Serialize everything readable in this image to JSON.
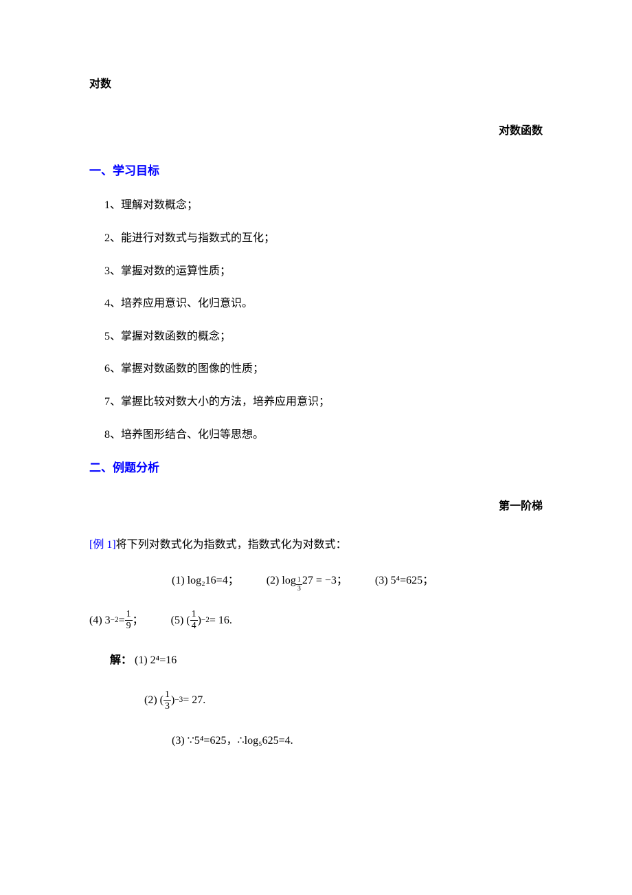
{
  "title_main": "对数",
  "title_right": "对数函数",
  "section1": {
    "heading": "一、学习目标",
    "goals": [
      "1、理解对数概念；",
      "2、能进行对数式与指数式的互化；",
      "3、掌握对数的运算性质；",
      "4、培养应用意识、化归意识。",
      "5、掌握对数函数的概念；",
      "6、掌握对数函数的图像的性质；",
      "7、掌握比较对数大小的方法，培养应用意识；",
      "8、培养图形结合、化归等思想。"
    ]
  },
  "section2": {
    "heading": "二、例题分析",
    "stage": "第一阶梯",
    "example": {
      "label": "[例 1]",
      "text": "将下列对数式化为指数式，指数式化为对数式：",
      "eq1": "(1) log₂16=4；",
      "eq2_pre": "(2) log",
      "eq2_sub_num": "1",
      "eq2_sub_den": "3",
      "eq2_post": " 27 = −3；",
      "eq3": "(3) 5⁴=625；",
      "eq4_pre": "(4) 3",
      "eq4_sup": "−2",
      "eq4_mid": " = ",
      "eq4_num": "1",
      "eq4_den": "9",
      "eq4_post": "；",
      "eq5_pre": "(5) (",
      "eq5_num": "1",
      "eq5_den": "4",
      "eq5_mid1": ")",
      "eq5_sup": "−2",
      "eq5_post": " = 16."
    },
    "solution": {
      "label": "解：",
      "s1": "(1) 2⁴=16",
      "s2_pre": "(2) (",
      "s2_num": "1",
      "s2_den": "3",
      "s2_mid": ")",
      "s2_sup": "−3",
      "s2_post": " = 27.",
      "s3": "(3) ∵5⁴=625，∴log₅625=4."
    }
  }
}
